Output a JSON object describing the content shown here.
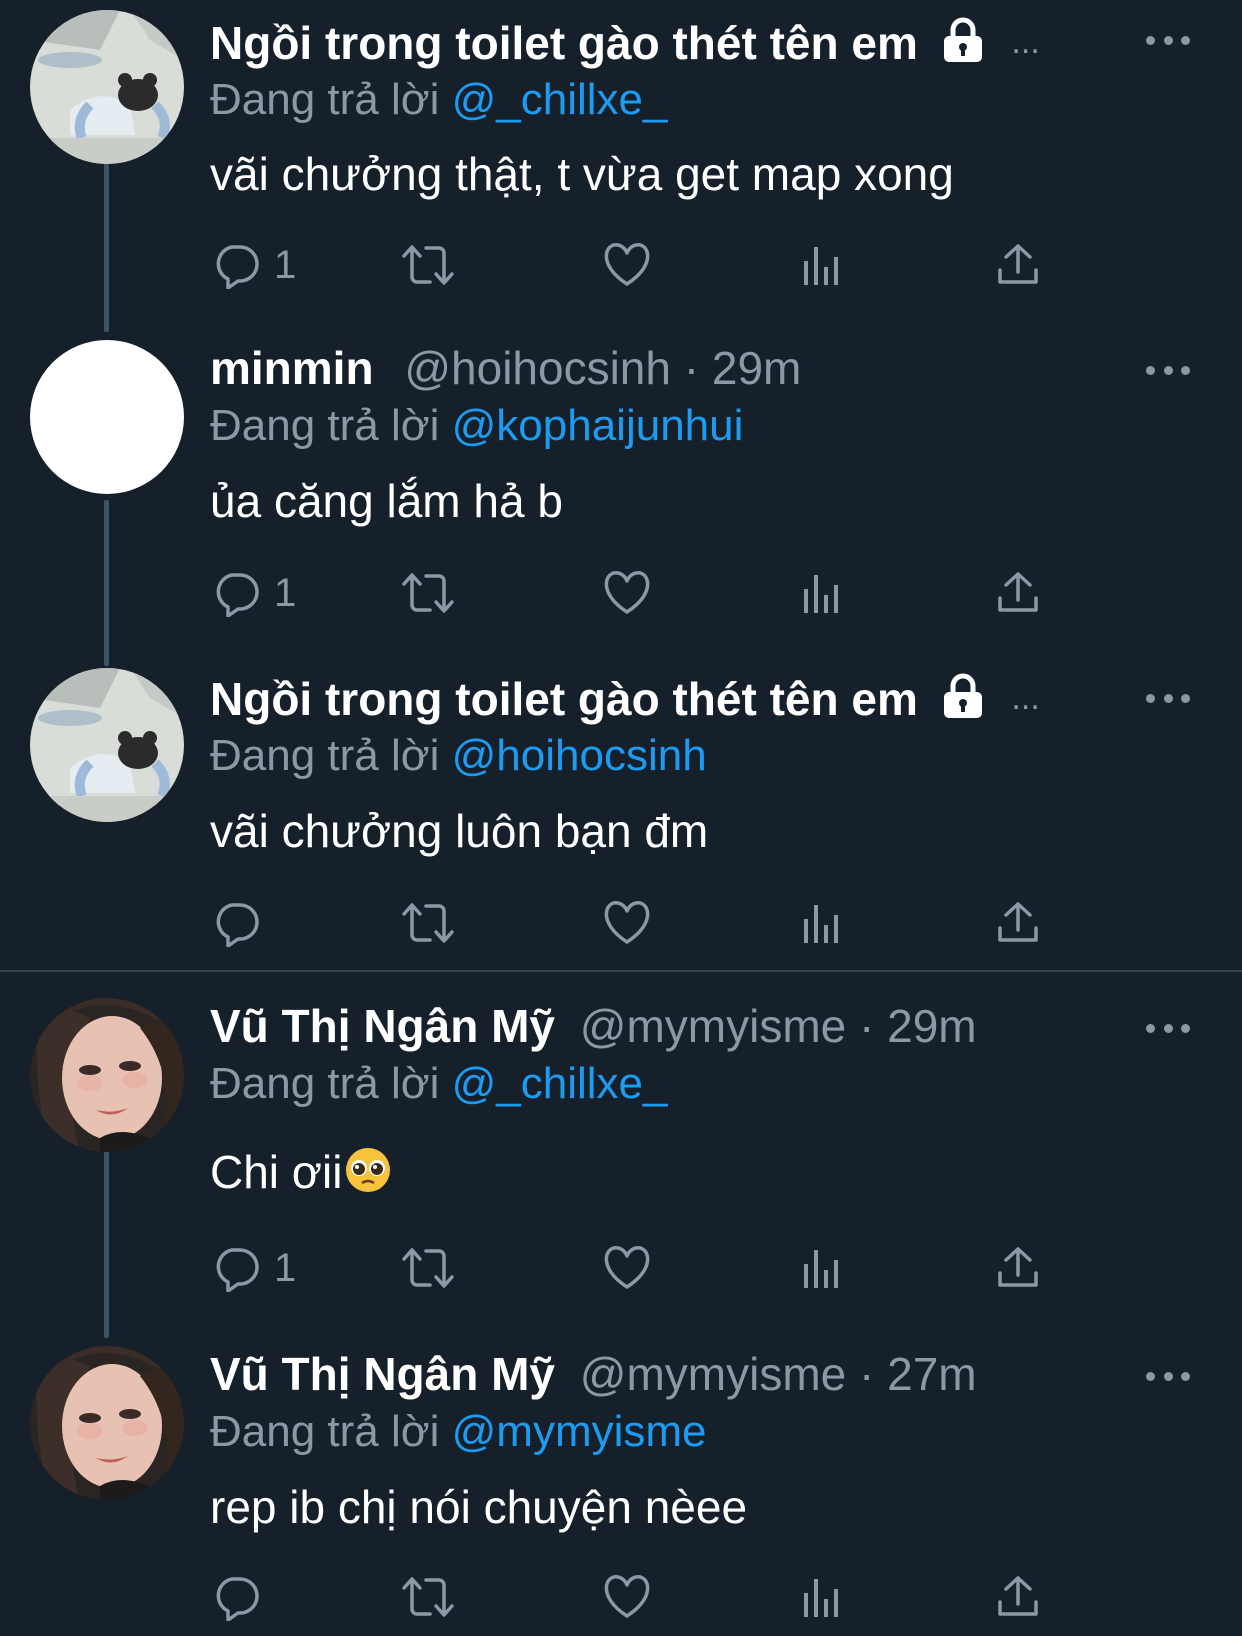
{
  "tweets": [
    {
      "name": "Ngồi trong toilet gào thét tên em",
      "handle": "",
      "time": "",
      "name_ellipsis": "...",
      "reply_prefix": "Đang trả lời",
      "reply_to": "@_chillxe_",
      "text": "vãi chưởng thật, t vừa get map xong",
      "reply_count": "1",
      "avatar": "cartoon-avatar"
    },
    {
      "name": "minmin",
      "handle": "@hoihocsinh",
      "dot": "·",
      "time": "29m",
      "reply_prefix": "Đang trả lời",
      "reply_to": "@kophaijunhui",
      "text": "ủa căng lắm hả b",
      "reply_count": "1",
      "avatar": "blank-avatar"
    },
    {
      "name": "Ngồi trong toilet gào thét tên em",
      "handle": "",
      "time": "",
      "name_ellipsis": "...",
      "reply_prefix": "Đang trả lời",
      "reply_to": "@hoihocsinh",
      "text": "vãi chưởng luôn bạn đm",
      "reply_count": "",
      "avatar": "cartoon-avatar"
    },
    {
      "name": "Vũ Thị Ngân Mỹ",
      "handle": "@mymyisme",
      "dot": "·",
      "time": "29m",
      "reply_prefix": "Đang trả lời",
      "reply_to": "@_chillxe_",
      "text": "Chi ơii",
      "reply_count": "1",
      "avatar": "photo-avatar"
    },
    {
      "name": "Vũ Thị Ngân Mỹ",
      "handle": "@mymyisme",
      "dot": "·",
      "time": "27m",
      "reply_prefix": "Đang trả lời",
      "reply_to": "@mymyisme",
      "text": "rep ib chị nói chuyện nèee",
      "reply_count": "",
      "avatar": "photo-avatar"
    }
  ],
  "colors": {
    "background": "#15202b",
    "text": "#ffffff",
    "secondary": "#8b98a5",
    "accent": "#1d9bf0",
    "thread_line": "#3d5466",
    "separator": "#38444d"
  },
  "icons": [
    "reply-icon",
    "retweet-icon",
    "like-icon",
    "views-icon",
    "share-icon",
    "more-icon",
    "lock-icon",
    "pleading-face-emoji"
  ]
}
